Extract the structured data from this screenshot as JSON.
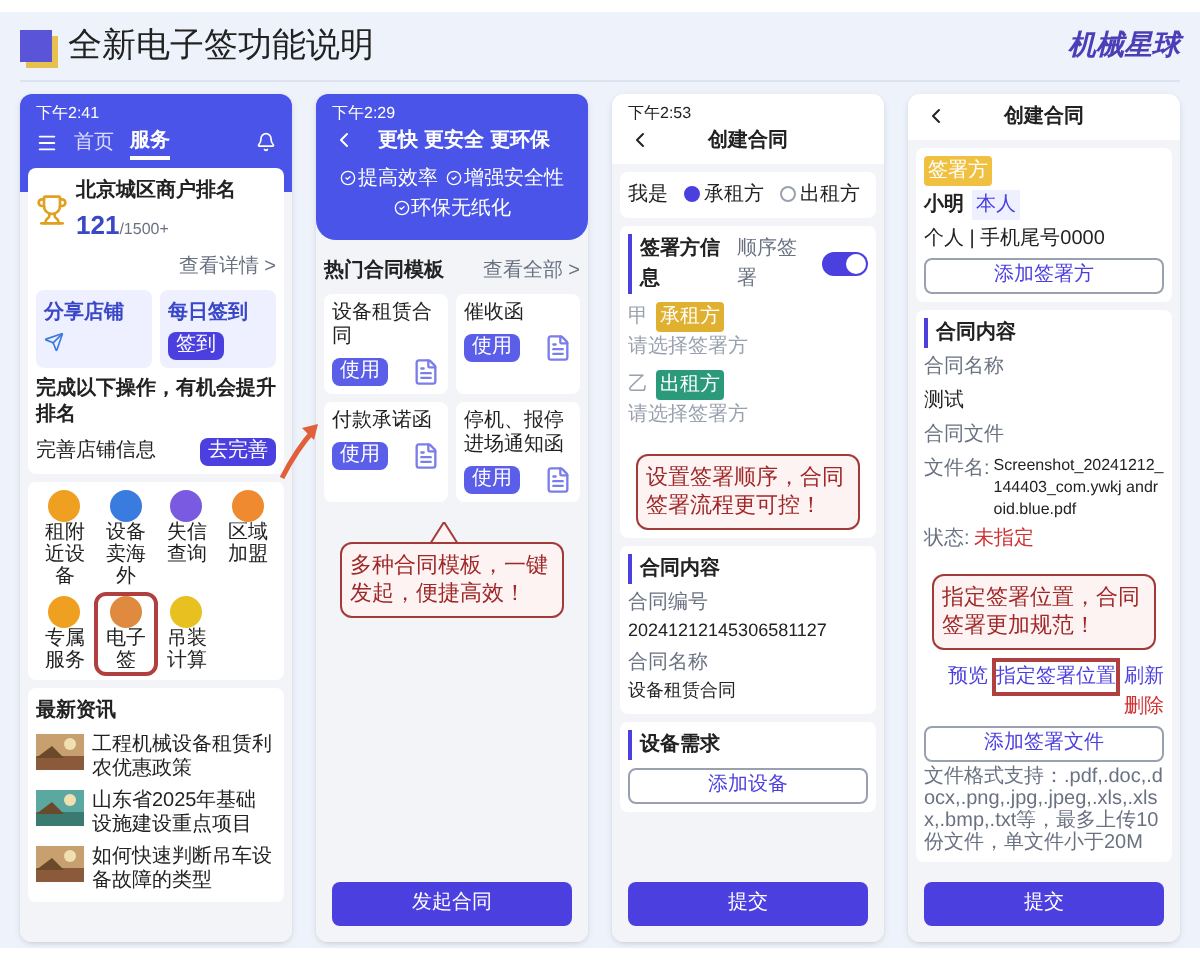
{
  "header": {
    "title": "全新电子签功能说明",
    "brand": "机械星球"
  },
  "phones": [
    {
      "kind": "home",
      "time": "下午2:41",
      "tabs": [
        {
          "label": "首页",
          "selected": false
        },
        {
          "label": "服务",
          "selected": true
        }
      ],
      "rank": {
        "title": "北京城区商户排名",
        "value": "121",
        "total": "/1500+",
        "link": "查看详情 >"
      },
      "tiles": [
        {
          "label": "分享店铺"
        },
        {
          "label": "每日签到",
          "button": "签到"
        }
      ],
      "task": {
        "title": "完成以下操作，有机会提升排名",
        "item": "完善店铺信息",
        "button": "去完善"
      },
      "services": [
        {
          "label": "租附近设备",
          "color": "#f0a020",
          "selected": false
        },
        {
          "label": "设备卖海外",
          "color": "#3a7be0",
          "selected": false
        },
        {
          "label": "失信查询",
          "color": "#7a5ae0",
          "selected": false
        },
        {
          "label": "区域加盟",
          "color": "#f08a30",
          "selected": false
        },
        {
          "label": "专属服务",
          "color": "#f0a020",
          "selected": false
        },
        {
          "label": "电子签",
          "color": "#e08a40",
          "selected": true
        },
        {
          "label": "吊装计算",
          "color": "#e8c020",
          "selected": false
        }
      ],
      "news": {
        "title": "最新资讯",
        "items": [
          "工程机械设备租赁利农优惠政策",
          "山东省2025年基础设施建设重点项目",
          "如何快速判断吊车设备故障的类型"
        ]
      }
    },
    {
      "kind": "templates",
      "time": "下午2:29",
      "title": "更快 更安全 更环保",
      "features": [
        "提高效率",
        "增强安全性",
        "环保无纸化"
      ],
      "section": "热门合同模板",
      "more": "查看全部 >",
      "templates": [
        {
          "name": "设备租赁合同",
          "button": "使用"
        },
        {
          "name": "催收函",
          "button": "使用"
        },
        {
          "name": "付款承诺函",
          "button": "使用"
        },
        {
          "name": "停机、报停进场通知函",
          "button": "使用"
        }
      ],
      "callout": "多种合同模板，一键发起，便捷高效！",
      "action": "发起合同"
    },
    {
      "kind": "create_sign",
      "time": "下午2:53",
      "title": "创建合同",
      "role": {
        "label": "我是",
        "options": [
          {
            "label": "承租方",
            "selected": true
          },
          {
            "label": "出租方",
            "selected": false
          }
        ]
      },
      "signers": {
        "title": "签署方信息",
        "toggle_label": "顺序签署",
        "on": true,
        "items": [
          {
            "mark": "甲",
            "role": "承租方",
            "color": "#e0b030",
            "hint": "请选择签署方"
          },
          {
            "mark": "乙",
            "role": "出租方",
            "color": "#2a9a7a",
            "hint": "请选择签署方"
          }
        ]
      },
      "callout": "设置签署顺序，合同签署流程更可控！",
      "content": {
        "title": "合同内容",
        "fields": [
          {
            "label": "合同编号",
            "value": "20241212145306581127"
          },
          {
            "label": "合同名称",
            "value": "设备租赁合同"
          }
        ]
      },
      "equipment": {
        "title": "设备需求",
        "button": "添加设备"
      },
      "submit": "提交"
    },
    {
      "kind": "create_file",
      "title": "创建合同",
      "signer": {
        "badge": "签署方",
        "name": "小明",
        "tag": "本人",
        "detail": "个人 | 手机尾号0000"
      },
      "add_signer": "添加签署方",
      "content": {
        "title": "合同内容",
        "name_label": "合同名称",
        "name": "测试",
        "file_label": "合同文件",
        "file_name_label": "文件名:",
        "file_name": "Screenshot_20241212_144403_com.ywkj android.blue.pdf",
        "status_label": "状态:",
        "status": "未指定",
        "actions": [
          {
            "label": "预览",
            "kind": "normal",
            "selected": false
          },
          {
            "label": "指定签署位置",
            "kind": "normal",
            "selected": true
          },
          {
            "label": "刷新",
            "kind": "normal",
            "selected": false
          },
          {
            "label": "删除",
            "kind": "danger",
            "selected": false
          }
        ],
        "add_file": "添加签署文件",
        "hint": "文件格式支持：.pdf,.doc,.docx,.png,.jpg,.jpeg,.xls,.xlsx,.bmp,.txt等，最多上传10份文件，单文件小于20M"
      },
      "callout": "指定签署位置，合同签署更加规范！",
      "submit": "提交"
    }
  ]
}
